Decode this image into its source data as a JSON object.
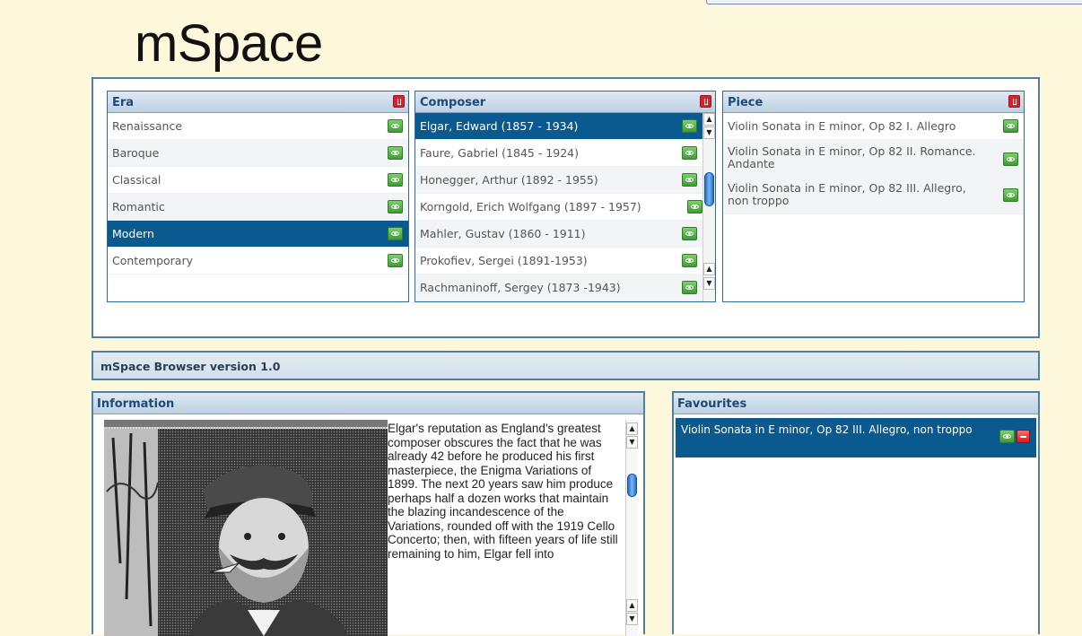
{
  "page": {
    "title": "mSpace"
  },
  "columns": [
    {
      "header": "Era",
      "items": [
        "Renaissance",
        "Baroque",
        "Classical",
        "Romantic",
        "Modern",
        "Contemporary"
      ],
      "selected": "Modern"
    },
    {
      "header": "Composer",
      "items": [
        "Elgar, Edward (1857 - 1934)",
        "Faure, Gabriel (1845 - 1924)",
        "Honegger, Arthur (1892 - 1955)",
        "Korngold, Erich Wolfgang (1897 - 1957)",
        "Mahler, Gustav (1860 - 1911)",
        "Prokofiev, Sergei (1891-1953)",
        "Rachmaninoff, Sergey (1873 -1943)"
      ],
      "selected": "Elgar, Edward (1857 - 1934)"
    },
    {
      "header": "Piece",
      "items": [
        "Violin Sonata in E minor, Op 82 I. Allegro",
        "Violin Sonata in E minor, Op 82 II. Romance. Andante",
        "Violin Sonata in E minor, Op 82 III. Allegro, non troppo"
      ]
    }
  ],
  "status_bar": {
    "label": "mSpace Browser version 1.0"
  },
  "information": {
    "header": "Information",
    "text": "Elgar's reputation as England's greatest composer obscures the fact that he was already 42 before he produced his first masterpiece, the Enigma Variations of 1899. The next 20 years saw him produce perhaps half a dozen works that maintain the blazing incandescence of the Variations, rounded off with the 1919 Cello Concerto; then, with fifteen years of life still remaining to him, Elgar fell into"
  },
  "favourites": {
    "header": "Favourites",
    "items": [
      "Violin Sonata in E minor, Op 82 III. Allegro, non troppo"
    ]
  },
  "icons": {
    "column_close": "close-column-icon",
    "preview": "eye-icon",
    "remove": "remove-icon"
  },
  "colors": {
    "background": "#fdf8dc",
    "selection": "#0b5a8f",
    "header_text": "#1d4b78",
    "panel_border": "#4d7fa7"
  }
}
